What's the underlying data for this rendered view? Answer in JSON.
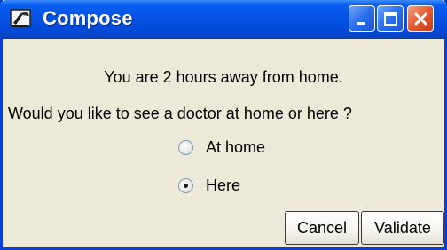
{
  "window": {
    "title": "Compose",
    "title_icon": "compose-app-icon",
    "titlebar_color": "#0454e6",
    "controls": {
      "minimize_icon": "minimize-icon",
      "maximize_icon": "maximize-icon",
      "close_icon": "close-icon"
    }
  },
  "dialog": {
    "message": "You are 2 hours away from home.",
    "question": "Would you like to see a doctor at home or here ?",
    "options": [
      {
        "label": "At home",
        "selected": false
      },
      {
        "label": "Here",
        "selected": true
      }
    ],
    "buttons": {
      "cancel": "Cancel",
      "validate": "Validate"
    }
  }
}
